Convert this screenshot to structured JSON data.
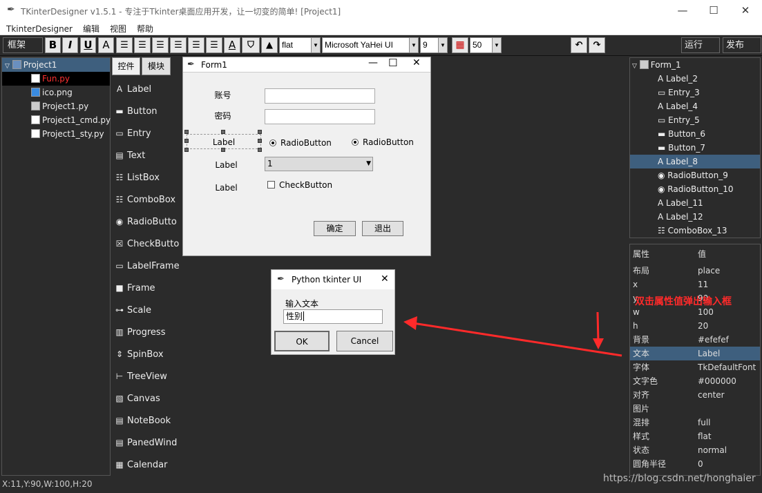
{
  "window": {
    "title": "TKinterDesigner v1.5.1 - 专注于Tkinter桌面应用开发，让一切变的简单!    [Project1]",
    "minimize": "—",
    "maximize": "☐",
    "close": "✕"
  },
  "menu": [
    "TkinterDesigner",
    "编辑",
    "视图",
    "帮助"
  ],
  "toolbar": {
    "frame_select": "框架",
    "bold": "B",
    "italic": "I",
    "underline": "U",
    "font_a": "A",
    "relief": "flat",
    "font_family": "Microsoft YaHei UI",
    "font_size": "9",
    "grid_size": "50",
    "run": "运行",
    "publish": "发布"
  },
  "project_tree": {
    "root": "Project1",
    "items": [
      {
        "name": "Fun.py",
        "selected": true
      },
      {
        "name": "ico.png",
        "selected": false
      },
      {
        "name": "Project1.py",
        "selected": false
      },
      {
        "name": "Project1_cmd.py",
        "selected": false
      },
      {
        "name": "Project1_sty.py",
        "selected": false
      }
    ]
  },
  "widget_panel": {
    "tabs": [
      "控件",
      "模块"
    ],
    "items": [
      "Label",
      "Button",
      "Entry",
      "Text",
      "ListBox",
      "ComboBox",
      "RadioButto",
      "CheckButto",
      "LabelFrame",
      "Frame",
      "Scale",
      "Progress",
      "SpinBox",
      "TreeView",
      "Canvas",
      "NoteBook",
      "PanedWind",
      "Calendar"
    ]
  },
  "form": {
    "title": "Form1",
    "label_account": "账号",
    "label_password": "密码",
    "label_selected": "Label",
    "radio1": "RadioButton",
    "radio2": "RadioButton",
    "label2": "Label",
    "combo_value": "1",
    "label3": "Label",
    "checkbutton": "CheckButton",
    "ok": "确定",
    "exit": "退出"
  },
  "dialog": {
    "title": "Python tkinter UI",
    "prompt": "输入文本",
    "input_value": "性别",
    "ok": "OK",
    "cancel": "Cancel"
  },
  "object_tree": {
    "root": "Form_1",
    "items": [
      "Label_2",
      "Entry_3",
      "Label_4",
      "Entry_5",
      "Button_6",
      "Button_7",
      "Label_8",
      "RadioButton_9",
      "RadioButton_10",
      "Label_11",
      "Label_12",
      "ComboBox_13"
    ],
    "selected": "Label_8"
  },
  "properties": {
    "header_key": "属性",
    "header_value": "值",
    "rows": [
      {
        "k": "布局",
        "v": "place"
      },
      {
        "k": "x",
        "v": "11"
      },
      {
        "k": "y",
        "v": "90"
      },
      {
        "k": "w",
        "v": "100"
      },
      {
        "k": "h",
        "v": "20"
      },
      {
        "k": "背景",
        "v": "#efefef"
      },
      {
        "k": "文本",
        "v": "Label"
      },
      {
        "k": "字体",
        "v": "TkDefaultFont"
      },
      {
        "k": "文字色",
        "v": "#000000"
      },
      {
        "k": "对齐",
        "v": "center"
      },
      {
        "k": "图片",
        "v": ""
      },
      {
        "k": "混排",
        "v": "full"
      },
      {
        "k": "样式",
        "v": "flat"
      },
      {
        "k": "状态",
        "v": "normal"
      },
      {
        "k": "圆角半径",
        "v": "0"
      }
    ],
    "selected_key": "文本"
  },
  "annotation": "双击属性值弹出输入框",
  "status": "X:11,Y:90,W:100,H:20",
  "watermark": "https://blog.csdn.net/honghaier",
  "colors": {
    "accent_red": "#ff2a2a",
    "selection": "#3e5f7e",
    "selected_file": "#ff3030"
  }
}
